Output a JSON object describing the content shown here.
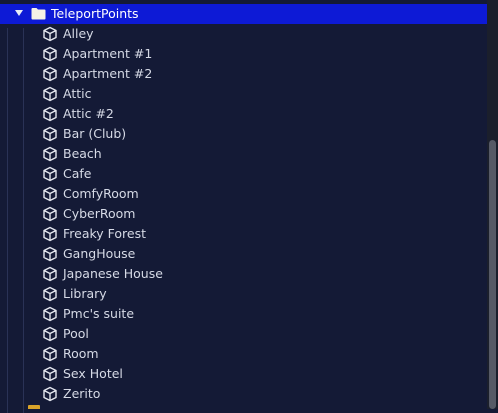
{
  "tree": {
    "folder": {
      "label": "TeleportPoints",
      "icon": "folder-icon",
      "expanded": true,
      "color": "#f2c94c"
    },
    "items": [
      {
        "label": "Alley",
        "icon": "cube-icon"
      },
      {
        "label": "Apartment #1",
        "icon": "cube-icon"
      },
      {
        "label": "Apartment #2",
        "icon": "cube-icon"
      },
      {
        "label": "Attic",
        "icon": "cube-icon"
      },
      {
        "label": "Attic #2",
        "icon": "cube-icon"
      },
      {
        "label": "Bar (Club)",
        "icon": "cube-icon"
      },
      {
        "label": "Beach",
        "icon": "cube-icon"
      },
      {
        "label": "Cafe",
        "icon": "cube-icon"
      },
      {
        "label": "ComfyRoom",
        "icon": "cube-icon"
      },
      {
        "label": "CyberRoom",
        "icon": "cube-icon"
      },
      {
        "label": "Freaky Forest",
        "icon": "cube-icon"
      },
      {
        "label": "GangHouse",
        "icon": "cube-icon"
      },
      {
        "label": "Japanese House",
        "icon": "cube-icon"
      },
      {
        "label": "Library",
        "icon": "cube-icon"
      },
      {
        "label": "Pmc's suite",
        "icon": "cube-icon"
      },
      {
        "label": "Pool",
        "icon": "cube-icon"
      },
      {
        "label": "Room",
        "icon": "cube-icon"
      },
      {
        "label": "Sex Hotel",
        "icon": "cube-icon"
      },
      {
        "label": "Zerito",
        "icon": "cube-icon"
      }
    ]
  },
  "colors": {
    "background": "#141a36",
    "selection": "#0d1ad6",
    "text": "#d6dae6",
    "scrollbar_track": "#1b1f2c",
    "scrollbar_thumb": "#565a66"
  }
}
